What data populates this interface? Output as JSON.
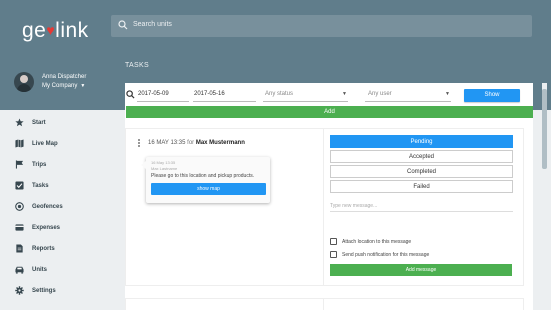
{
  "app": {
    "logo_text_before": "ge",
    "logo_text_after": "link"
  },
  "search": {
    "placeholder": "Search units"
  },
  "page": {
    "title": "TASKS"
  },
  "user": {
    "name": "Anna Dispatcher",
    "company": "My Company"
  },
  "sidebar": {
    "items": [
      {
        "label": "Start",
        "icon": "star-icon"
      },
      {
        "label": "Live Map",
        "icon": "map-icon"
      },
      {
        "label": "Trips",
        "icon": "flag-icon"
      },
      {
        "label": "Tasks",
        "icon": "checkbox-icon"
      },
      {
        "label": "Geofences",
        "icon": "target-icon"
      },
      {
        "label": "Expenses",
        "icon": "credit-card-icon"
      },
      {
        "label": "Reports",
        "icon": "document-icon"
      },
      {
        "label": "Units",
        "icon": "car-icon"
      },
      {
        "label": "Settings",
        "icon": "gear-icon"
      }
    ]
  },
  "filters": {
    "date_from": "2017-05-09",
    "date_to": "2017-05-16",
    "status": "Any status",
    "user": "Any user",
    "show_label": "Show"
  },
  "add_label": "Add",
  "task": {
    "timestamp": "16 MAY 13:35",
    "for_label": "for",
    "assignee": "Max Mustermann",
    "message": {
      "meta_date": "16 May 13:35",
      "meta_author": "Max Lastname",
      "text": "Please go to this location and pickup products.",
      "button": "show map"
    },
    "statuses": [
      "Pending",
      "Accepted",
      "Completed",
      "Failed"
    ],
    "active_status": "Pending",
    "message_placeholder": "Type new message...",
    "attach_label": "Attach location to this message",
    "push_label": "Send push notification for this message",
    "add_message_label": "Add message"
  },
  "colors": {
    "header": "#607d8b",
    "primary": "#2196f3",
    "success": "#4caf50",
    "brand_accent": "#e53935"
  }
}
